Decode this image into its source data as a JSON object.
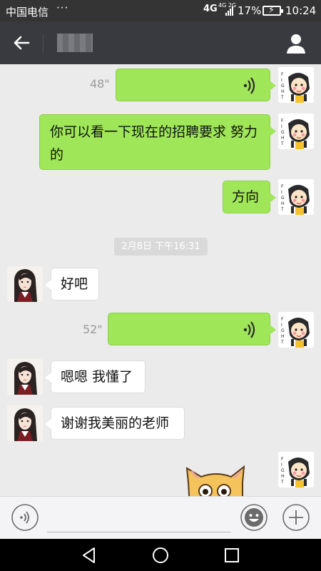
{
  "status_bar": {
    "carrier": "中国电信",
    "dots": "···",
    "network": "4G",
    "network_secondary": "4G 2G",
    "battery": "17%",
    "time": "10:24"
  },
  "title_bar": {
    "back_icon": "arrow-left-icon",
    "contact_name": "",
    "profile_icon": "person-icon"
  },
  "chat": {
    "timestamp": "2月8日 下午16:31",
    "messages": [
      {
        "from": "me",
        "type": "voice",
        "duration": "48\""
      },
      {
        "from": "me",
        "type": "text",
        "line1": "你可以看一下现在的招聘要求 努力",
        "line2": "的"
      },
      {
        "from": "me",
        "type": "text",
        "text": "方向"
      },
      {
        "from": "other",
        "type": "text",
        "text": "好吧"
      },
      {
        "from": "me",
        "type": "voice",
        "duration": "52\""
      },
      {
        "from": "other",
        "type": "text",
        "text": "嗯嗯 我懂了"
      },
      {
        "from": "other",
        "type": "text",
        "text": "谢谢我美丽的老师"
      },
      {
        "from": "me",
        "type": "sticker",
        "sticker": "cat-sticker"
      }
    ]
  },
  "input_bar": {
    "voice_icon": "voice-mode-icon",
    "emoji_icon": "emoji-icon",
    "add_icon": "plus-icon"
  },
  "nav_bar": {
    "back": "triangle-back-icon",
    "home": "circle-home-icon",
    "recents": "square-recents-icon"
  },
  "colors": {
    "my_bubble": "#9fe658",
    "other_bubble": "#ffffff",
    "title_bar": "#393a3f",
    "chat_bg": "#ebebeb"
  }
}
